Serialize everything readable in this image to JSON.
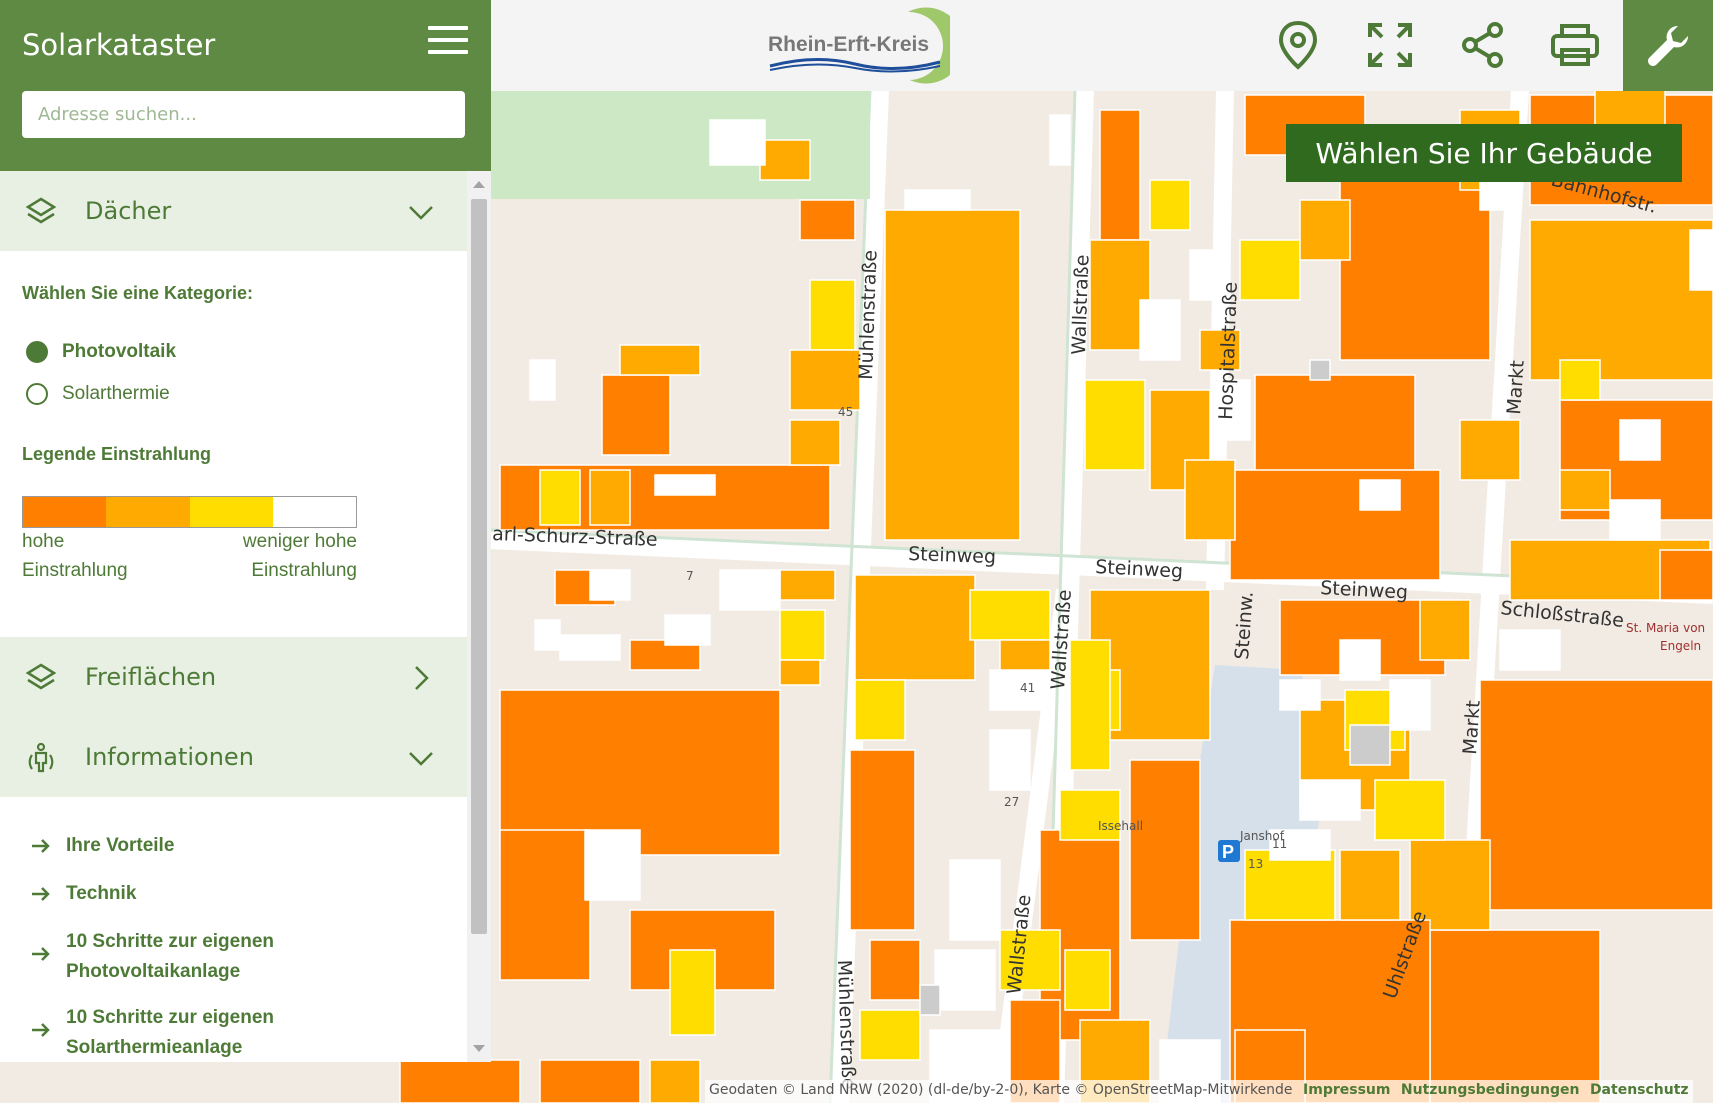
{
  "app": {
    "title": "Solarkataster",
    "logo_text": "Rhein-Erft-Kreis"
  },
  "search": {
    "placeholder": "Adresse suchen..."
  },
  "toolbar": {
    "location_icon": "location-pin-icon",
    "fullscreen_icon": "fullscreen-icon",
    "share_icon": "share-icon",
    "print_icon": "print-icon",
    "tools_icon": "wrench-icon"
  },
  "map": {
    "banner": "Wählen Sie Ihr Gebäude",
    "streets": {
      "muehlenstrasse": "Mühlenstraße",
      "wallstrasse": "Wallstraße",
      "hospitalstrasse": "Hospitalstraße",
      "markt": "Markt",
      "karl_schurz": "arl-Schurz-Straße",
      "steinweg": "Steinweg",
      "steinw": "Steinw.",
      "schlossstrasse": "Schloßstraße",
      "uhlstrasse": "Uhlstraße",
      "bahnhofstr": "Bahnhofstr.",
      "st_maria": "St. Maria von",
      "engeln": "Engeln",
      "janshof": "Janshof",
      "issehalle": "Issehall"
    },
    "house_numbers": [
      "45",
      "7",
      "27",
      "41",
      "11",
      "13"
    ],
    "parking": "P",
    "attribution": "Geodaten © Land NRW (2020) (dl-de/by-2-0), Karte © OpenStreetMap-Mitwirkende",
    "links": [
      "Impressum",
      "Nutzungsbedingungen",
      "Datenschutz"
    ]
  },
  "sidebar": {
    "sections": {
      "daecher": "Dächer",
      "freiflaechen": "Freiflächen",
      "informationen": "Informationen"
    },
    "kategorie_label": "Wählen Sie eine Kategorie:",
    "categories": [
      {
        "label": "Photovoltaik",
        "selected": true
      },
      {
        "label": "Solarthermie",
        "selected": false
      }
    ],
    "legend": {
      "title": "Legende Einstrahlung",
      "colors": [
        "#ff8000",
        "#ffaa00",
        "#ffdd00",
        "#ffffff"
      ],
      "left_line1": "hohe",
      "left_line2": "Einstrahlung",
      "right_line1": "weniger hohe",
      "right_line2": "Einstrahlung"
    },
    "info_links": [
      "Ihre Vorteile",
      "Technik",
      "10 Schritte zur eigenen Photovoltaikanlage",
      "10 Schritte zur eigenen Solarthermieanlage"
    ]
  },
  "colors": {
    "brand_green": "#5e8a43",
    "dark_green": "#2f6a1f",
    "light_green": "#e8f0e4",
    "roof_high": "#ff8000",
    "roof_mid": "#ffaa00",
    "roof_low": "#ffdd00"
  }
}
